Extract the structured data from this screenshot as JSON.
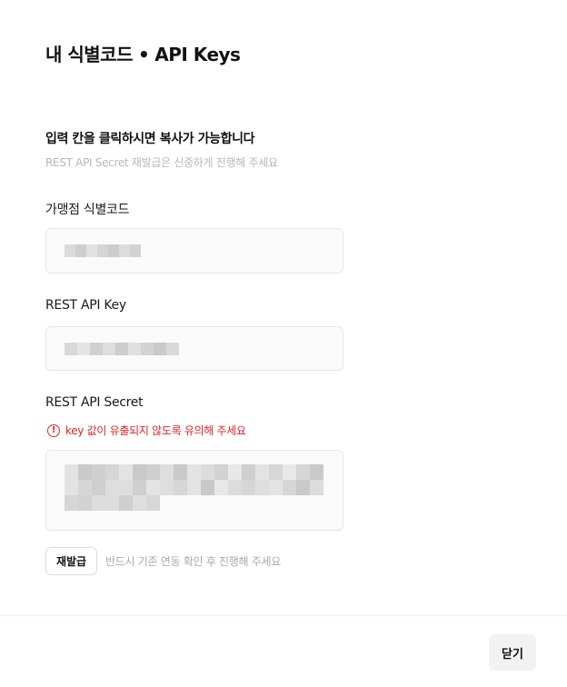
{
  "header": {
    "title_left": "내 식별코드",
    "title_separator": "•",
    "title_right": "API Keys"
  },
  "notice": {
    "heading": "입력 칸을 클릭하시면 복사가 가능합니다",
    "subtext": "REST API Secret 재발급은 신중하게 진행해 주세요"
  },
  "fields": {
    "merchant_code": {
      "label": "가맹점 식별코드"
    },
    "rest_api_key": {
      "label": "REST API Key"
    },
    "rest_api_secret": {
      "label": "REST API Secret",
      "warning": "key 값이 유출되지 않도록 유의해 주세요"
    }
  },
  "reissue": {
    "button_label": "재발급",
    "hint": "반드시 기존 연동 확인 후 진행해 주세요"
  },
  "footer": {
    "close_label": "닫기"
  },
  "icons": {
    "warning": "exclamation-circle-icon"
  },
  "colors": {
    "warning": "#e02424",
    "muted_text": "#b5b7bc",
    "field_bg": "#fafafa",
    "close_bg": "#f2f2f3"
  }
}
